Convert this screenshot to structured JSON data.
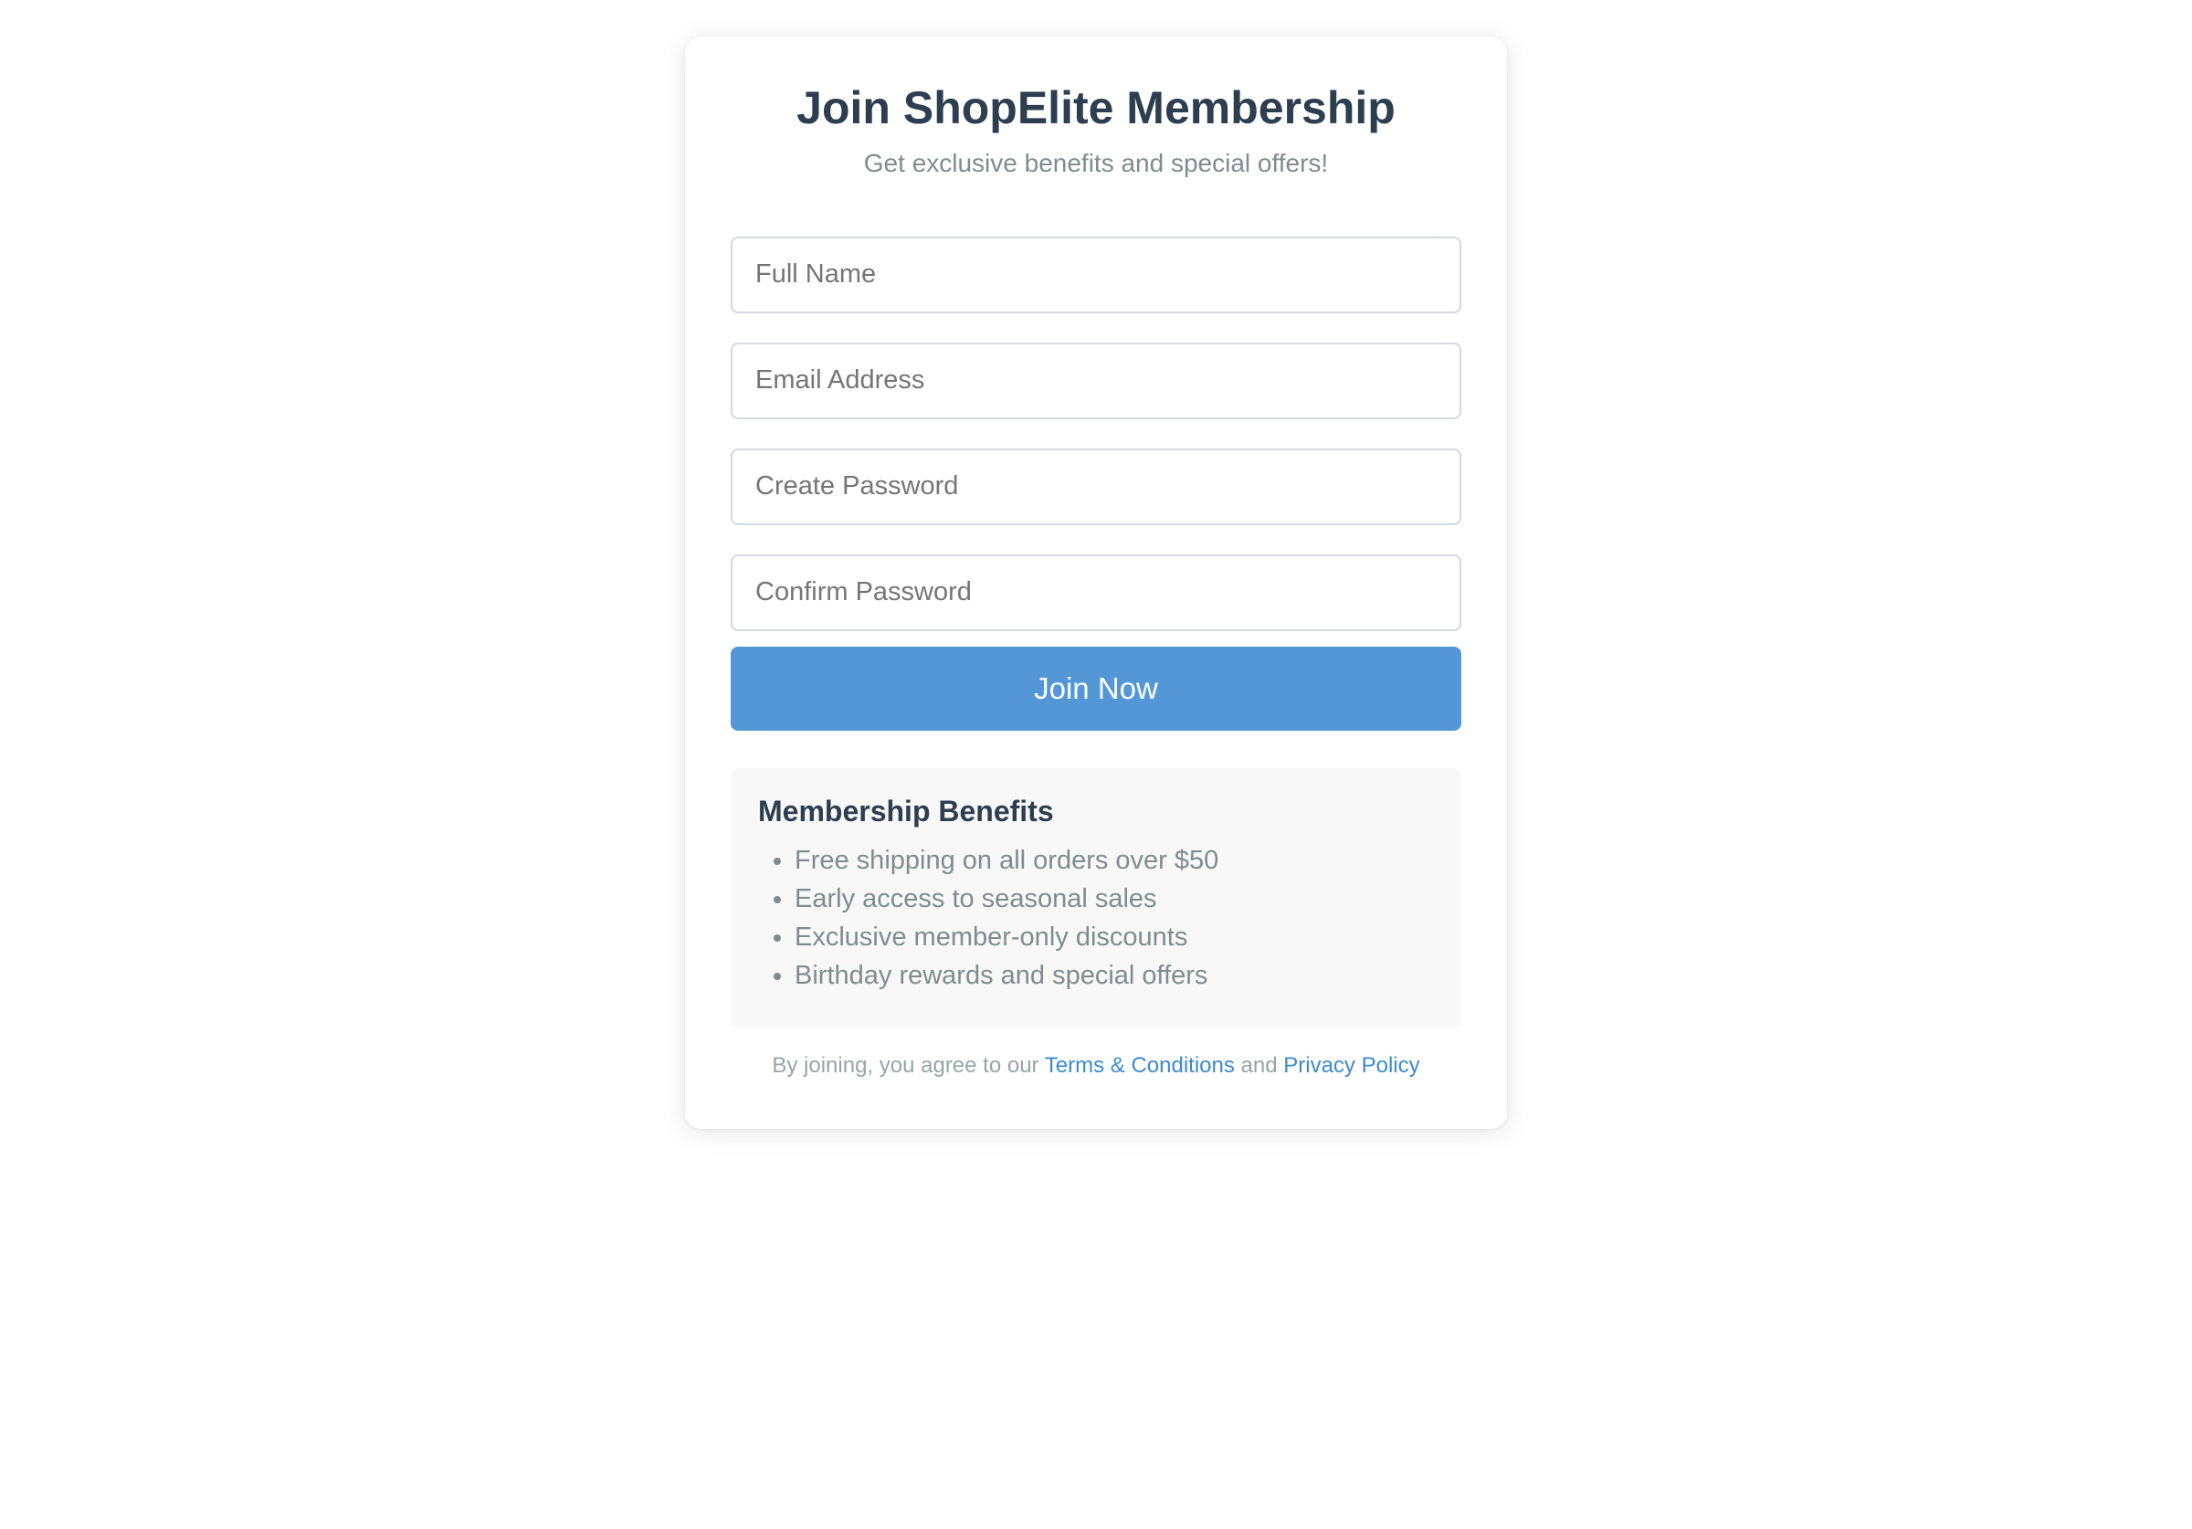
{
  "header": {
    "title": "Join ShopElite Membership",
    "subtitle": "Get exclusive benefits and special offers!"
  },
  "form": {
    "full_name": {
      "placeholder": "Full Name",
      "value": ""
    },
    "email": {
      "placeholder": "Email Address",
      "value": ""
    },
    "password": {
      "placeholder": "Create Password",
      "value": ""
    },
    "confirm_password": {
      "placeholder": "Confirm Password",
      "value": ""
    },
    "submit_label": "Join Now"
  },
  "benefits": {
    "title": "Membership Benefits",
    "items": [
      "Free shipping on all orders over $50",
      "Early access to seasonal sales",
      "Exclusive member-only discounts",
      "Birthday rewards and special offers"
    ]
  },
  "terms": {
    "prefix": "By joining, you agree to our",
    "terms_link": "Terms & Conditions",
    "conjunction": "and",
    "privacy_link": "Privacy Policy"
  },
  "colors": {
    "primary": "#5397d6",
    "heading": "#2c3e50",
    "muted": "#7f8c8d",
    "link": "#3d8ad0",
    "panel": "#f8f8f8"
  }
}
